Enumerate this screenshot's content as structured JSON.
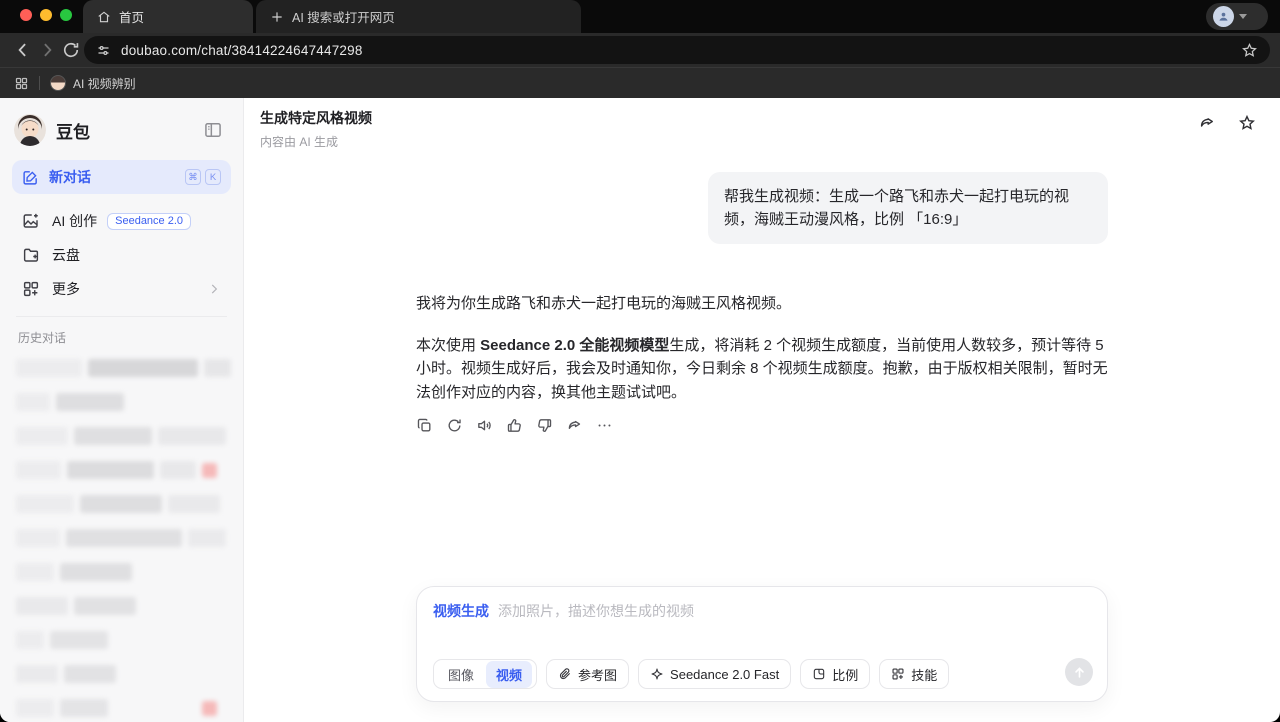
{
  "browser": {
    "tab_label": "首页",
    "new_tab_label": "AI 搜索或打开网页",
    "url": "doubao.com/chat/38414224647447298",
    "bookmark_label": "AI 视频辨别",
    "traffic": {
      "red": "#ff5f57",
      "yellow": "#febc2e",
      "green": "#28c840"
    }
  },
  "sidebar": {
    "brand": "豆包",
    "new_chat": {
      "label": "新对话",
      "key1": "⌘",
      "key2": "K"
    },
    "items": {
      "creation": {
        "label": "AI 创作",
        "badge": "Seedance 2.0"
      },
      "drive": {
        "label": "云盘"
      },
      "more": {
        "label": "更多"
      }
    },
    "history_label": "历史对话",
    "history_rows": [
      {
        "segments": [
          [
            68,
            "#ececee"
          ],
          [
            112,
            "#d7d7d9"
          ],
          [
            28,
            "#e6e6e8"
          ]
        ],
        "red": false
      },
      {
        "segments": [
          [
            34,
            "#ececee"
          ],
          [
            68,
            "#dedee0"
          ]
        ],
        "red": false
      },
      {
        "segments": [
          [
            52,
            "#ececee"
          ],
          [
            78,
            "#dfdfe1"
          ],
          [
            68,
            "#e8e8ea"
          ]
        ],
        "red": false
      },
      {
        "segments": [
          [
            48,
            "#ececee"
          ],
          [
            92,
            "#dcdcde"
          ],
          [
            38,
            "#e8e8ea"
          ]
        ],
        "red": true
      },
      {
        "segments": [
          [
            58,
            "#ececee"
          ],
          [
            82,
            "#dedee0"
          ],
          [
            52,
            "#e9e9eb"
          ]
        ],
        "red": false
      },
      {
        "segments": [
          [
            44,
            "#ececee"
          ],
          [
            116,
            "#e0e0e2"
          ],
          [
            38,
            "#eaeaec"
          ]
        ],
        "red": false
      },
      {
        "segments": [
          [
            38,
            "#ececee"
          ],
          [
            72,
            "#dfdfe1"
          ]
        ],
        "red": false
      },
      {
        "segments": [
          [
            52,
            "#e9e9eb"
          ],
          [
            62,
            "#e1e1e3"
          ]
        ],
        "red": false
      },
      {
        "segments": [
          [
            28,
            "#ececee"
          ],
          [
            58,
            "#e3e3e5"
          ]
        ],
        "red": false
      },
      {
        "segments": [
          [
            42,
            "#eaeaec"
          ],
          [
            52,
            "#e2e2e4"
          ]
        ],
        "red": false
      },
      {
        "segments": [
          [
            38,
            "#ececee"
          ],
          [
            48,
            "#e4e4e6"
          ]
        ],
        "red": true
      }
    ]
  },
  "chat": {
    "title": "生成特定风格视频",
    "subtitle": "内容由 AI 生成",
    "user_message": "帮我生成视频：生成一个路飞和赤犬一起打电玩的视频，海贼王动漫风格，比例 「16:9」",
    "assistant": {
      "p1": "我将为你生成路飞和赤犬一起打电玩的海贼王风格视频。",
      "p2_prefix": "本次使用 ",
      "p2_bold": "Seedance 2.0 全能视频模型",
      "p2_suffix": "生成，将消耗 2 个视频生成额度，当前使用人数较多，预计等待 5 小时。视频生成好后，我会及时通知你，今日剩余 8 个视频生成额度。抱歉，由于版权相关限制，暂时无法创作对应的内容，换其他主题试试吧。"
    }
  },
  "composer": {
    "mode_tag": "视频生成",
    "placeholder": "添加照片，描述你想生成的视频",
    "image_label": "图像",
    "video_label": "视频",
    "reference_label": "参考图",
    "model_label": "Seedance 2.0 Fast",
    "ratio_label": "比例",
    "skill_label": "技能"
  },
  "colors": {
    "accent": "#3a5ef0",
    "accent_bg": "#e5eafc",
    "history_flag": "#f5b9b9"
  }
}
